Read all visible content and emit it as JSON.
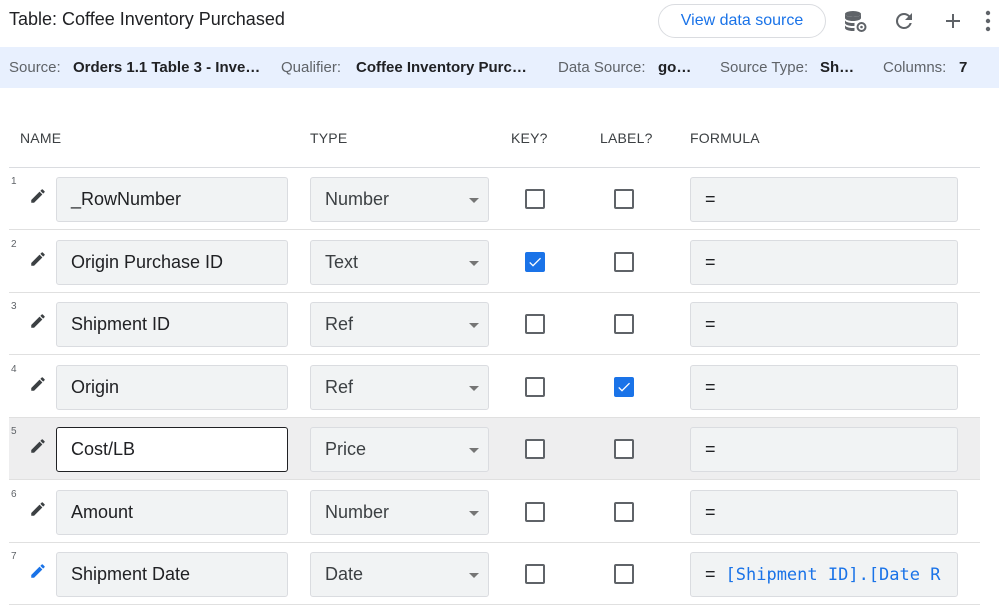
{
  "header": {
    "title": "Table: Coffee Inventory Purchased",
    "view_data_source_label": "View data source",
    "icons": [
      "database-settings-icon",
      "refresh-icon",
      "add-icon",
      "more-vert-icon"
    ]
  },
  "info": {
    "source_label": "Source:",
    "source_value": "Orders 1.1 Table 3 - Inve…",
    "qualifier_label": "Qualifier:",
    "qualifier_value": "Coffee Inventory Purc…",
    "datasource_label": "Data Source:",
    "datasource_value": "go…",
    "sourcetype_label": "Source Type:",
    "sourcetype_value": "Sh…",
    "columns_label": "Columns:",
    "columns_value": "7"
  },
  "columns": {
    "name": "NAME",
    "type": "TYPE",
    "key": "KEY?",
    "label": "LABEL?",
    "formula": "FORMULA"
  },
  "rows": [
    {
      "num": "1",
      "name": "_RowNumber",
      "type": "Number",
      "key": false,
      "label": false,
      "formula_eq": "=",
      "formula_expr": ""
    },
    {
      "num": "2",
      "name": "Origin Purchase ID",
      "type": "Text",
      "key": true,
      "label": false,
      "formula_eq": "=",
      "formula_expr": ""
    },
    {
      "num": "3",
      "name": "Shipment ID",
      "type": "Ref",
      "key": false,
      "label": false,
      "formula_eq": "=",
      "formula_expr": ""
    },
    {
      "num": "4",
      "name": "Origin",
      "type": "Ref",
      "key": false,
      "label": true,
      "formula_eq": "=",
      "formula_expr": ""
    },
    {
      "num": "5",
      "name": "Cost/LB",
      "type": "Price",
      "key": false,
      "label": false,
      "formula_eq": "=",
      "formula_expr": ""
    },
    {
      "num": "6",
      "name": "Amount",
      "type": "Number",
      "key": false,
      "label": false,
      "formula_eq": "=",
      "formula_expr": ""
    },
    {
      "num": "7",
      "name": "Shipment Date",
      "type": "Date",
      "key": false,
      "label": false,
      "formula_eq": "=",
      "formula_expr": "[Shipment ID].[Date R"
    }
  ],
  "selected_row": 4,
  "colors": {
    "accent": "#1a73e8",
    "strip_bg": "#e8f0fe",
    "selected_row_bg": "#eeeeef"
  }
}
